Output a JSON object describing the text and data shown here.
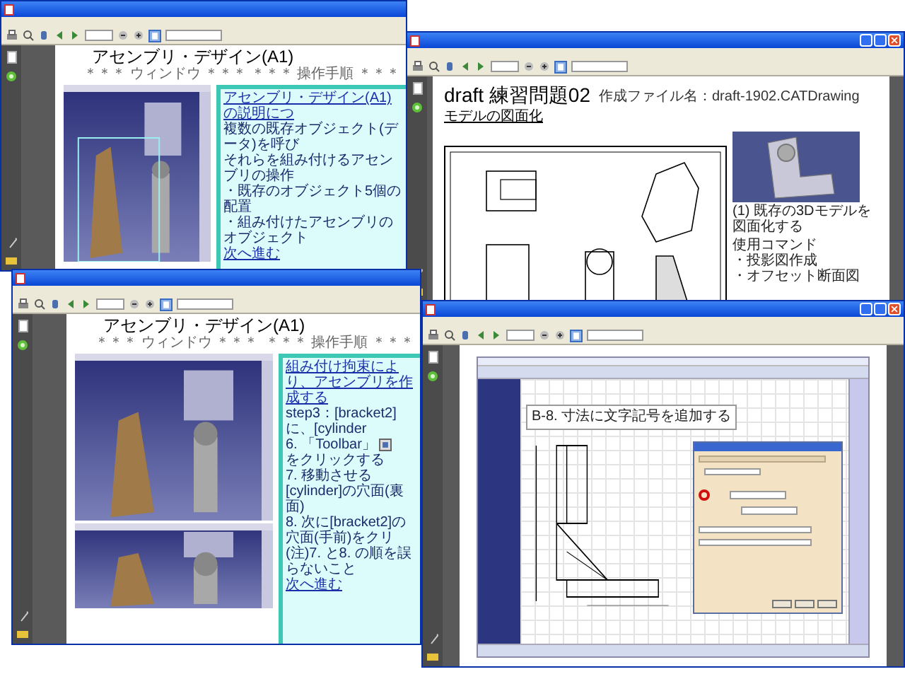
{
  "windows": [
    {
      "kind": "assembly_overview",
      "page": {
        "title": "アセンブリ・デザイン(A1)",
        "left_label": "＊＊＊ ウィンドウ ＊＊＊",
        "right_label": "＊＊＊ 操作手順 ＊＊＊"
      },
      "panel": [
        {
          "kind": "link",
          "text": "アセンブリ・デザイン(A1)の説明につ"
        },
        {
          "kind": "text",
          "text": "複数の既存オブジェクト(データ)を呼び"
        },
        {
          "kind": "text",
          "text": "それらを組み付けるアセンブリの操作"
        },
        {
          "kind": "text",
          "text": "・既存のオブジェクト5個の配置"
        },
        {
          "kind": "text",
          "text": "・組み付けたアセンブリのオブジェクト"
        },
        {
          "kind": "link",
          "text": "次へ進む"
        }
      ]
    },
    {
      "kind": "draft",
      "page": {
        "title": "draft 練習問題02",
        "file_label": "作成ファイル名：draft-1902.CATDrawing",
        "section": "モデルの図面化",
        "caption": "(1) 既存の3Dモデルを図面化する",
        "commands_label": "使用コマンド",
        "commands": [
          "・投影図作成",
          "・オフセット断面図"
        ]
      }
    },
    {
      "kind": "assembly_steps",
      "page": {
        "title": "アセンブリ・デザイン(A1)",
        "left_label": "＊＊＊ ウィンドウ ＊＊＊",
        "right_label": "＊＊＊ 操作手順 ＊＊＊"
      },
      "panel": [
        {
          "kind": "link",
          "text": "組み付け拘束により、アセンブリを作成する"
        },
        {
          "kind": "text",
          "text": "step3：[bracket2] に、[cylinder"
        },
        {
          "kind": "icon_step",
          "before": "6. 「Toolbar」",
          "after": "をクリックする"
        },
        {
          "kind": "text",
          "text": "7. 移動させる[cylinder]の穴面(裏面)"
        },
        {
          "kind": "text",
          "text": "8. 次に[bracket2]の穴面(手前)をクリ"
        },
        {
          "kind": "text",
          "text": "(注)7. と8. の順を誤らないこと"
        },
        {
          "kind": "link",
          "text": "次へ進む"
        }
      ]
    },
    {
      "kind": "dimension",
      "page": {
        "heading": "B-8. 寸法に文字記号を追加する"
      }
    }
  ]
}
